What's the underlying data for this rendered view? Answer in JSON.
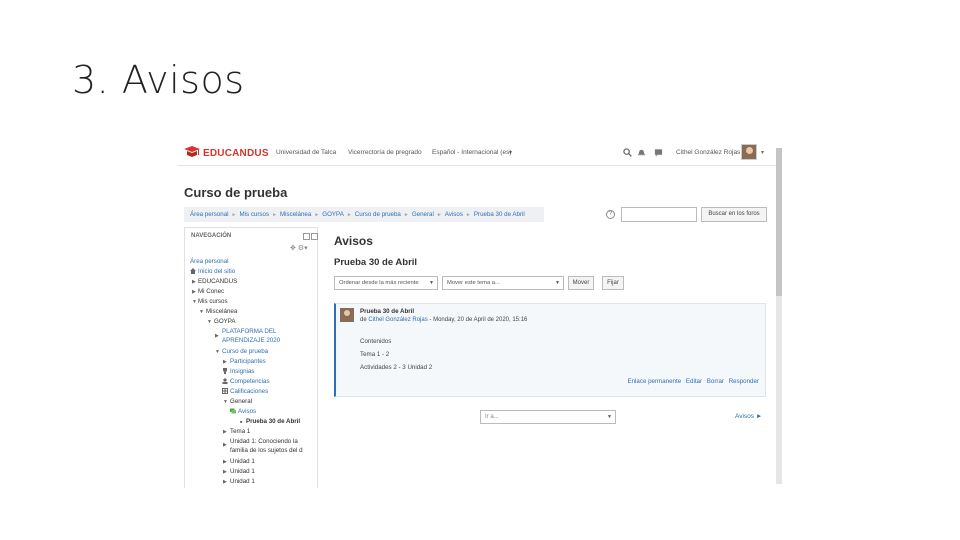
{
  "slide": {
    "title": "3. Avisos"
  },
  "navbar": {
    "brand": "EDUCANDUS",
    "links": [
      "Universidad de Talca",
      "Vicerrectoría de pregrado",
      "Español - Internacional (es)"
    ],
    "user": "Cithel González Rojas"
  },
  "header": {
    "course_title": "Curso de prueba",
    "breadcrumb": [
      "Área personal",
      "Mis cursos",
      "Miscelánea",
      "GOYPA",
      "Curso de prueba",
      "General",
      "Avisos",
      "Prueba 30 de Abril"
    ],
    "search_button": "Buscar en los foros"
  },
  "sidebar": {
    "title": "NAVEGACIÓN",
    "items": [
      "Área personal",
      "Inicio del sitio",
      "EDUCANDUS",
      "Mi Conec",
      "Mis cursos",
      "Miscelánea",
      "GOYPA",
      "PLATAFORMA DEL",
      "APRENDIZAJE 2020",
      "Curso de prueba",
      "Participantes",
      "Insignias",
      "Competencias",
      "Calificaciones",
      "General",
      "Avisos",
      "Prueba 30 de Abril",
      "Tema 1",
      "Unidad 1: Conociendo la",
      "familia de los sujetos del d",
      "Unidad 1",
      "Unidad 1",
      "Unidad 1"
    ]
  },
  "main": {
    "forum_title": "Avisos",
    "discussion_title": "Prueba 30 de Abril",
    "sort_select": "Ordenar desde la más reciente",
    "move_select": "Mover este tema a...",
    "move_button": "Mover",
    "pin_button": "Fijar",
    "post": {
      "subject": "Prueba 30 de Abril",
      "author_prefix": "de",
      "author": "Cithel González Rojas",
      "date": "- Monday, 20 de April de 2020, 15:16",
      "lines": [
        "Contenidos",
        "Tema 1 - 2",
        "Actividades 2 - 3 Unidad 2"
      ],
      "links": [
        "Enlace permanente",
        "Editar",
        "Borrar",
        "Responder"
      ]
    },
    "jump_select": "Ir a...",
    "next_link": "Avisos ►"
  },
  "colors": {
    "brand": "#d9342b",
    "link": "#2f6fb3",
    "accent_border": "#2f6fb3"
  }
}
